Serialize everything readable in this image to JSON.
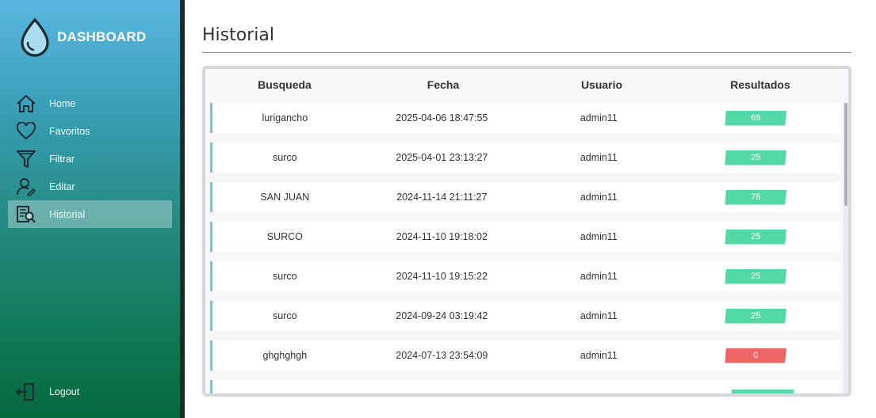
{
  "sidebar": {
    "brand": "DASHBOARD",
    "items": [
      {
        "label": "Home",
        "icon": "home-icon"
      },
      {
        "label": "Favoritos",
        "icon": "heart-icon"
      },
      {
        "label": "Filtrar",
        "icon": "filter-icon"
      },
      {
        "label": "Editar",
        "icon": "user-edit-icon"
      },
      {
        "label": "Historial",
        "icon": "history-icon",
        "active": true
      }
    ],
    "logout": "Logout"
  },
  "main": {
    "title": "Historial",
    "table": {
      "headers": [
        "Busqueda",
        "Fecha",
        "Usuario",
        "Resultados"
      ],
      "rows": [
        {
          "busqueda": "lurigancho",
          "fecha": "2025-04-06 18:47:55",
          "usuario": "admin11",
          "resultados": "69"
        },
        {
          "busqueda": "surco",
          "fecha": "2025-04-01 23:13:27",
          "usuario": "admin11",
          "resultados": "25"
        },
        {
          "busqueda": "SAN JUAN",
          "fecha": "2024-11-14 21:11:27",
          "usuario": "admin11",
          "resultados": "78"
        },
        {
          "busqueda": "SURCO",
          "fecha": "2024-11-10 19:18:02",
          "usuario": "admin11",
          "resultados": "25"
        },
        {
          "busqueda": "surco",
          "fecha": "2024-11-10 19:15:22",
          "usuario": "admin11",
          "resultados": "25"
        },
        {
          "busqueda": "surco",
          "fecha": "2024-09-24 03:19:42",
          "usuario": "admin11",
          "resultados": "25"
        },
        {
          "busqueda": "ghghghgh",
          "fecha": "2024-07-13 23:54:09",
          "usuario": "admin11",
          "resultados": "0"
        }
      ]
    }
  },
  "colors": {
    "badge_positive": "#53d9a6",
    "badge_zero": "#ee6565",
    "row_accent": "#6cc6e6"
  }
}
